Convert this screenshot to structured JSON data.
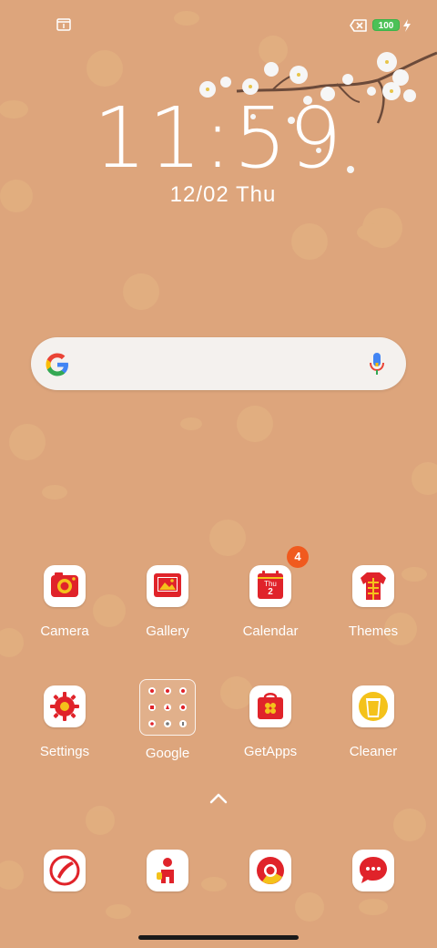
{
  "status_bar": {
    "battery_level": "100",
    "icons": [
      "calendar-notification-icon",
      "no-sim-icon",
      "battery-icon",
      "charging-icon"
    ]
  },
  "lockclock": {
    "time": "11:59",
    "date": "12/02 Thu"
  },
  "search_bar": {
    "icons": [
      "google-logo-icon",
      "microphone-icon"
    ]
  },
  "apps": {
    "row1": [
      {
        "label": "Camera",
        "icon": "camera-icon"
      },
      {
        "label": "Gallery",
        "icon": "gallery-icon"
      },
      {
        "label": "Calendar",
        "icon": "calendar-icon",
        "calendar_day": "Thu",
        "calendar_date": "2",
        "badge": "4"
      },
      {
        "label": "Themes",
        "icon": "themes-icon"
      }
    ],
    "row2": [
      {
        "label": "Settings",
        "icon": "settings-icon"
      },
      {
        "label": "Google",
        "icon": "folder-icon"
      },
      {
        "label": "GetApps",
        "icon": "getapps-icon"
      },
      {
        "label": "Cleaner",
        "icon": "cleaner-icon"
      }
    ]
  },
  "dock": [
    {
      "icon": "phone-icon"
    },
    {
      "icon": "contacts-icon"
    },
    {
      "icon": "chrome-icon"
    },
    {
      "icon": "messages-icon"
    }
  ],
  "colors": {
    "background": "#DDA57C",
    "icon_red": "#E0232A",
    "icon_yellow": "#F4C21B",
    "badge": "#F05A1E"
  }
}
